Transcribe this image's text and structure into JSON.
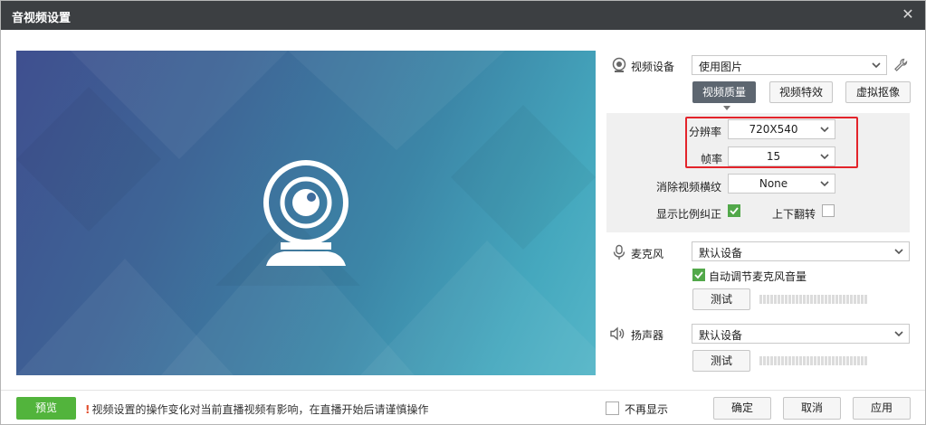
{
  "window": {
    "title": "音视频设置",
    "close_icon": "close-icon"
  },
  "video": {
    "label": "视频设备",
    "device": "使用图片",
    "tabs": [
      "视频质量",
      "视频特效",
      "虚拟抠像"
    ],
    "active_tab": "视频质量"
  },
  "quality": {
    "resolution_label": "分辨率",
    "resolution_value": "720X540",
    "framerate_label": "帧率",
    "framerate_value": "15",
    "deinterlace_label": "消除视频横纹",
    "deinterlace_value": "None",
    "aspect_label": "显示比例纠正",
    "aspect_checked": true,
    "flip_label": "上下翻转",
    "flip_checked": false
  },
  "mic": {
    "label": "麦克风",
    "device": "默认设备",
    "auto_gain_label": "自动调节麦克风音量",
    "auto_gain_checked": true,
    "test_label": "测试"
  },
  "speaker": {
    "label": "扬声器",
    "device": "默认设备",
    "test_label": "测试"
  },
  "footer": {
    "preview_label": "预览",
    "warning_mark": "!",
    "warning_text": "视频设置的操作变化对当前直播视频有影响，在直播开始后请谨慎操作",
    "no_show_label": "不再显示",
    "ok_label": "确定",
    "cancel_label": "取消",
    "apply_label": "应用"
  },
  "colors": {
    "accent_green": "#52b43c",
    "highlight_red": "#e3242b",
    "titlebar": "#3c3f42",
    "active_tab": "#5d6670"
  }
}
